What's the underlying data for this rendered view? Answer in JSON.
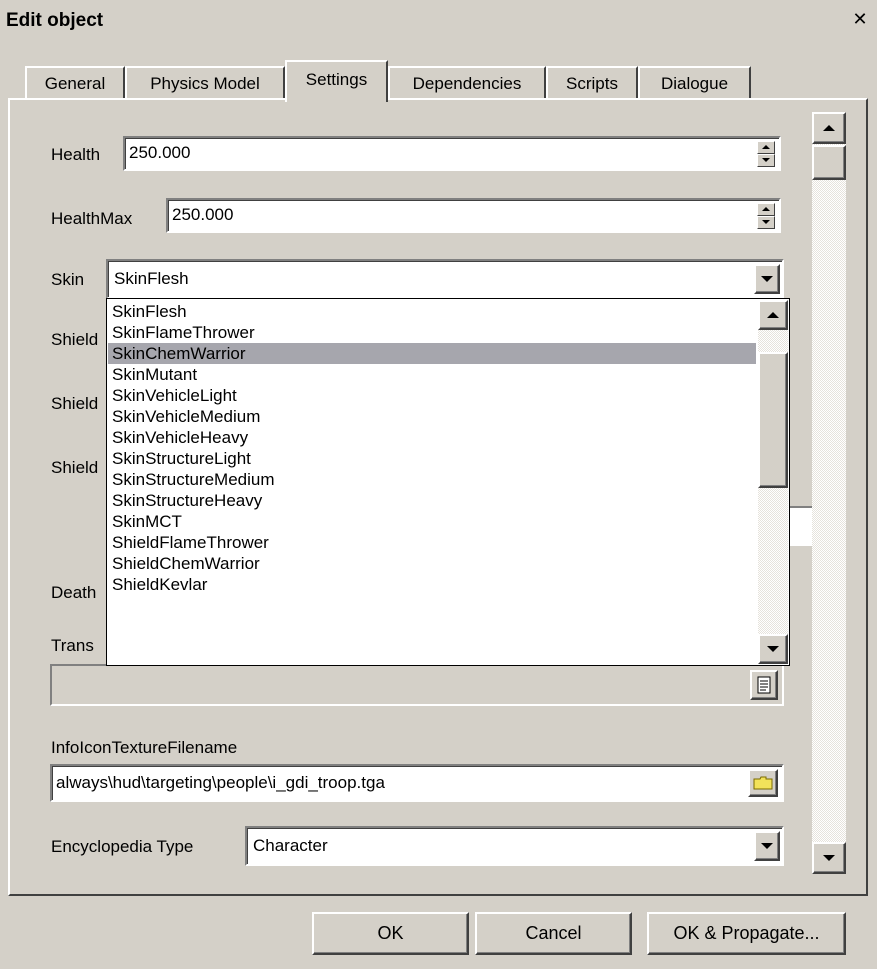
{
  "window": {
    "title": "Edit object",
    "close_glyph": "✕"
  },
  "tabs": [
    {
      "label": "General"
    },
    {
      "label": "Physics Model"
    },
    {
      "label": "Settings"
    },
    {
      "label": "Dependencies"
    },
    {
      "label": "Scripts"
    },
    {
      "label": "Dialogue"
    }
  ],
  "active_tab": "Settings",
  "fields": {
    "health": {
      "label": "Health",
      "value": "250.000"
    },
    "health_max": {
      "label": "HealthMax",
      "value": "250.000"
    },
    "skin": {
      "label": "Skin",
      "value": "SkinFlesh"
    },
    "shield1_label": "Shield",
    "shield2_label": "Shield",
    "shield3_label": "Shield",
    "death_label": "Death",
    "trans_label": "Trans",
    "infoicon": {
      "label": "InfoIconTextureFilename",
      "value": "always\\hud\\targeting\\people\\i_gdi_troop.tga"
    },
    "encyclopedia": {
      "label": "Encyclopedia Type",
      "value": "Character"
    }
  },
  "skin_dropdown": {
    "selected_index": 2,
    "options": [
      "SkinFlesh",
      "SkinFlameThrower",
      "SkinChemWarrior",
      "SkinMutant",
      "SkinVehicleLight",
      "SkinVehicleMedium",
      "SkinVehicleHeavy",
      "SkinStructureLight",
      "SkinStructureMedium",
      "SkinStructureHeavy",
      "SkinMCT",
      "ShieldFlameThrower",
      "ShieldChemWarrior",
      "ShieldKevlar"
    ]
  },
  "buttons": {
    "ok": "OK",
    "cancel": "Cancel",
    "ok_propagate": "OK & Propagate..."
  },
  "colors": {
    "face": "#d4d0c8",
    "selection": "#a6a6ad",
    "window": "#ffffff"
  }
}
